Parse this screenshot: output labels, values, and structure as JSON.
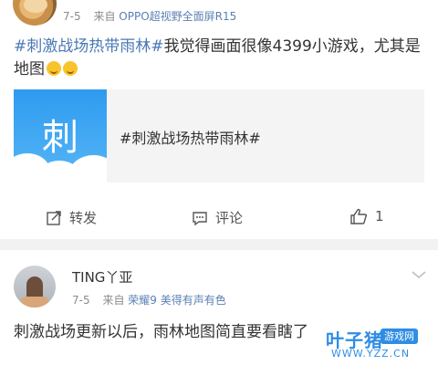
{
  "post1": {
    "date": "7-5",
    "from_prefix": "来自",
    "source": "OPPO超视野全面屏R15",
    "tag": "#刺激战场热带雨林#",
    "text": "我觉得画面很像4399小游戏，尤其是地图",
    "emoji_icon": "laugh-cry-emoji",
    "card": {
      "thumb_char": "刺",
      "title": "#刺激战场热带雨林#"
    }
  },
  "actions": {
    "repost": "转发",
    "comment": "评论",
    "like_count": "1"
  },
  "post2": {
    "username": "TING丫亚",
    "date": "7-5",
    "from_prefix": "来自",
    "source": "荣耀9 美得有声有色",
    "text": "刺激战场更新以后，雨林地图简直要看瞎了"
  },
  "watermark": {
    "logo": "叶子猪",
    "badge": "游戏网",
    "url": "WWW.YZZ.CN"
  },
  "colors": {
    "link": "#4a78b5",
    "source": "#5b7fb3",
    "meta": "#8c8c8c",
    "thumb": "#2e9bf0"
  }
}
